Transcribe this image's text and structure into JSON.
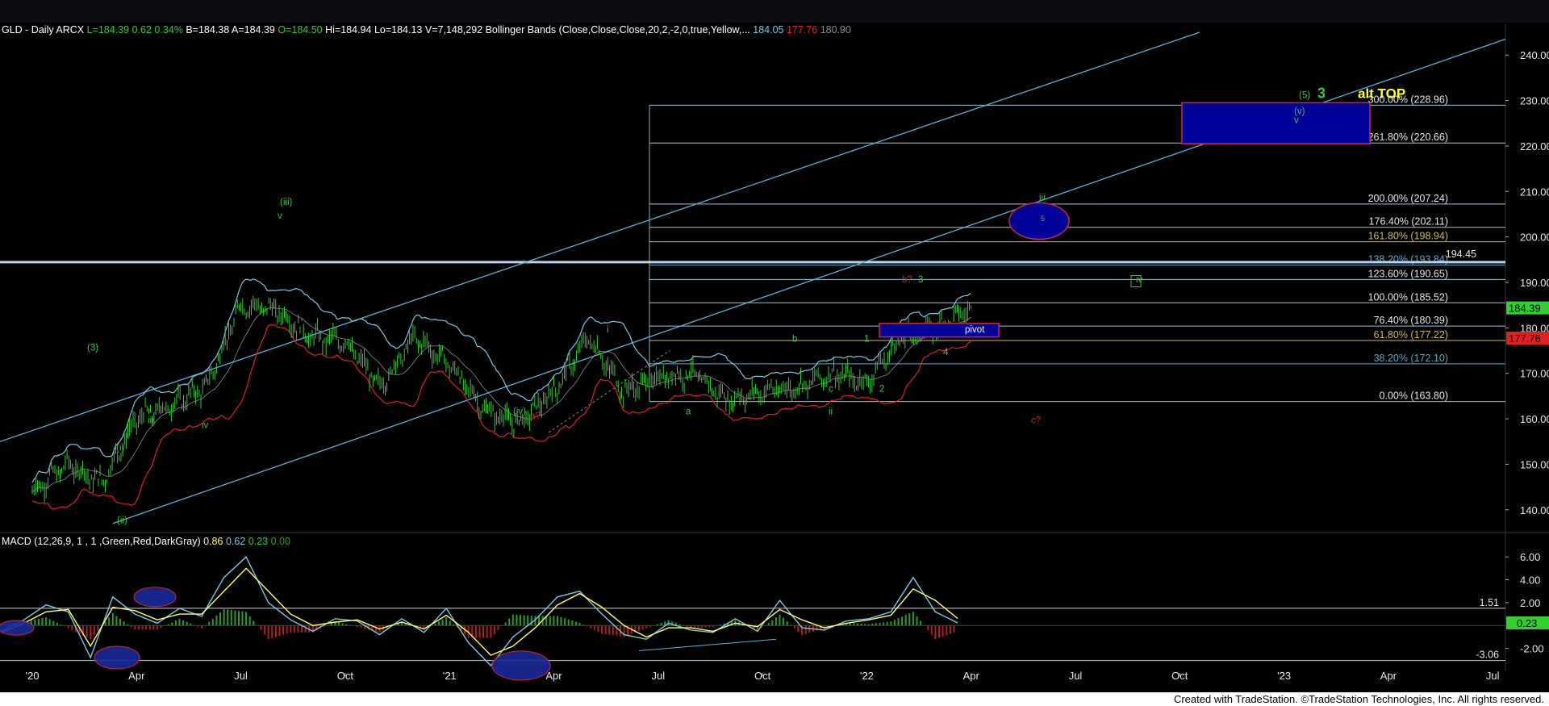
{
  "header": {
    "symbol_info": "GLD - Daily  ARCX",
    "last": "L=184.39",
    "change": "0.62",
    "change_pct": "0.34%",
    "bid": "B=184.38",
    "ask": "A=184.39",
    "open": "O=184.50",
    "high": "Hi=184.94",
    "low": "Lo=184.13",
    "volume": "V=7,148,292",
    "indicator": "Bollinger Bands (Close,Close,Close,20,2,-2,0,true,Yellow,...",
    "bb_upper": "184.05",
    "bb_lower": "177.76",
    "bb_mid": "180.90"
  },
  "macd_header": {
    "label": "MACD (12,26,9, 1 , 1 ,Green,Red,DarkGray)",
    "macd": "0.86",
    "signal": "0.62",
    "diff": "0.23",
    "zero": "0.00"
  },
  "footer": {
    "text": "Created with TradeStation. ©TradeStation Technologies, Inc. All rights reserved."
  },
  "colors": {
    "background": "#000000",
    "price_bars": "#3ec43e",
    "bb_upper": "#7ec8e3",
    "bb_lower": "#e02020",
    "bb_mid": "#c8c8c8",
    "channel": "#5fb0d8",
    "fib_lines": "#9fc4d8",
    "box_blue": "#000099",
    "box_border": "#cc2a3a",
    "wave_green": "#3ec43e",
    "wave_red": "#d02020",
    "alt_top": "#ffff33",
    "macd_line": "#7ec8e3",
    "signal_line": "#ffff66",
    "hist_pos": "#2e9a2e",
    "hist_neg": "#b02020"
  },
  "chart_data": [
    {
      "type": "candlestick",
      "title": "GLD - Daily  ARCX",
      "x_ticks": [
        "'20",
        "Apr",
        "Jul",
        "Oct",
        "'21",
        "Apr",
        "Jul",
        "Oct",
        "'22",
        "Apr",
        "Jul",
        "Oct",
        "'23",
        "Apr",
        "Jul"
      ],
      "y_ticks": [
        "140.00",
        "150.00",
        "160.00",
        "170.00",
        "180.00",
        "190.00",
        "200.00",
        "210.00",
        "220.00",
        "230.00",
        "240.00"
      ],
      "ylim": [
        135,
        245
      ],
      "x_months": [
        {
          "month": "2020-01",
          "close": 144
        },
        {
          "month": "2020-02",
          "close": 150
        },
        {
          "month": "2020-03",
          "close": 146
        },
        {
          "month": "2020-04",
          "close": 160
        },
        {
          "month": "2020-05",
          "close": 163
        },
        {
          "month": "2020-06",
          "close": 167
        },
        {
          "month": "2020-07",
          "close": 185
        },
        {
          "month": "2020-08",
          "close": 184
        },
        {
          "month": "2020-09",
          "close": 178
        },
        {
          "month": "2020-10",
          "close": 177
        },
        {
          "month": "2020-11",
          "close": 167
        },
        {
          "month": "2020-12",
          "close": 178
        },
        {
          "month": "2021-01",
          "close": 172
        },
        {
          "month": "2021-02",
          "close": 162
        },
        {
          "month": "2021-03",
          "close": 159
        },
        {
          "month": "2021-04",
          "close": 166
        },
        {
          "month": "2021-05",
          "close": 178
        },
        {
          "month": "2021-06",
          "close": 166
        },
        {
          "month": "2021-07",
          "close": 169
        },
        {
          "month": "2021-08",
          "close": 170
        },
        {
          "month": "2021-09",
          "close": 164
        },
        {
          "month": "2021-10",
          "close": 166
        },
        {
          "month": "2021-11",
          "close": 167
        },
        {
          "month": "2021-12",
          "close": 170
        },
        {
          "month": "2022-01",
          "close": 168
        },
        {
          "month": "2022-02",
          "close": 178
        },
        {
          "month": "2022-03",
          "close": 180
        },
        {
          "month": "2022-04",
          "close": 184.39
        }
      ],
      "last_price": "184.39",
      "bb_upper_tag": "184.05",
      "bb_lower_tag": "177.76",
      "resistance_tag": "194.45",
      "fib_levels": [
        {
          "label": "300.00% (228.96)",
          "value": 228.96
        },
        {
          "label": "261.80% (220.66)",
          "value": 220.66
        },
        {
          "label": "200.00% (207.24)",
          "value": 207.24
        },
        {
          "label": "176.40% (202.11)",
          "value": 202.11
        },
        {
          "label": "161.80% (198.94)",
          "value": 198.94
        },
        {
          "label": "138.20% (193.84)",
          "value": 193.84
        },
        {
          "label": "123.60% (190.65)",
          "value": 190.65
        },
        {
          "label": "100.00% (185.52)",
          "value": 185.52
        },
        {
          "label": "76.40% (180.39)",
          "value": 180.39
        },
        {
          "label": "61.80% (177.22)",
          "value": 177.22
        },
        {
          "label": "38.20% (172.10)",
          "value": 172.1
        },
        {
          "label": "0.00% (163.80)",
          "value": 163.8
        }
      ],
      "annotations": [
        {
          "text": "(3)",
          "color": "green"
        },
        {
          "text": "iii",
          "color": "green"
        },
        {
          "text": "(i)",
          "color": "green"
        },
        {
          "text": "(ii)",
          "color": "green"
        },
        {
          "text": "iv",
          "color": "green"
        },
        {
          "text": "(iii)",
          "color": "green"
        },
        {
          "text": "v",
          "color": "green"
        },
        {
          "text": "(iv)",
          "color": "green"
        },
        {
          "text": "a?",
          "color": "red"
        },
        {
          "text": "i",
          "color": "green"
        },
        {
          "text": "a",
          "color": "green"
        },
        {
          "text": "b",
          "color": "green"
        },
        {
          "text": "c",
          "color": "green"
        },
        {
          "text": "ii",
          "color": "green"
        },
        {
          "text": "1",
          "color": "green"
        },
        {
          "text": "2",
          "color": "green"
        },
        {
          "text": "b?",
          "color": "red"
        },
        {
          "text": "3",
          "color": "green"
        },
        {
          "text": "4",
          "color": "green"
        },
        {
          "text": "pivot",
          "color": "white"
        },
        {
          "text": "c?",
          "color": "red"
        },
        {
          "text": "iii",
          "color": "green"
        },
        {
          "text": "5",
          "color": "green"
        },
        {
          "text": "iv",
          "color": "green"
        },
        {
          "text": "(5)",
          "color": "green"
        },
        {
          "text": "3",
          "color": "green"
        },
        {
          "text": "alt TOP",
          "color": "yellow"
        },
        {
          "text": "(v)",
          "color": "green"
        },
        {
          "text": "v",
          "color": "green"
        }
      ]
    },
    {
      "type": "line",
      "title": "MACD (12,26,9, 1 , 1 ,Green,Red,DarkGray)",
      "y_ticks": [
        "6.00",
        "4.00",
        "2.00",
        "-2.00"
      ],
      "ylim": [
        -4,
        7
      ],
      "level_lines": [
        {
          "label": "1.51",
          "value": 1.51
        },
        {
          "label": "-3.06",
          "value": -3.06
        }
      ],
      "current_tag": "0.23",
      "series": [
        {
          "name": "MACD",
          "values": [
            -0.5,
            0.5,
            1.8,
            1.2,
            -2.8,
            2.5,
            1.0,
            0.2,
            1.5,
            0.8,
            4.2,
            6.0,
            2.0,
            0.5,
            -0.5,
            0.6,
            0.4,
            -0.8,
            0.6,
            -0.6,
            1.5,
            -1.5,
            -3.5,
            -1.0,
            0.5,
            2.5,
            3.0,
            1.0,
            -0.8,
            -1.2,
            0.2,
            -0.4,
            -0.6,
            0.6,
            -0.5,
            2.2,
            -0.2,
            -0.4,
            0.4,
            0.6,
            1.2,
            4.2,
            1.2,
            0.23
          ]
        },
        {
          "name": "Signal",
          "values": [
            -0.6,
            0.2,
            1.2,
            1.4,
            -1.8,
            1.6,
            1.3,
            0.5,
            1.0,
            1.0,
            3.0,
            5.0,
            3.0,
            1.0,
            0.0,
            0.3,
            0.5,
            -0.3,
            0.3,
            -0.3,
            0.9,
            -0.6,
            -2.6,
            -1.8,
            -0.2,
            1.8,
            2.8,
            1.6,
            0.0,
            -1.0,
            -0.2,
            -0.2,
            -0.5,
            0.2,
            -0.1,
            1.4,
            0.5,
            -0.2,
            0.2,
            0.5,
            0.9,
            3.2,
            2.2,
            0.62
          ]
        }
      ]
    }
  ]
}
